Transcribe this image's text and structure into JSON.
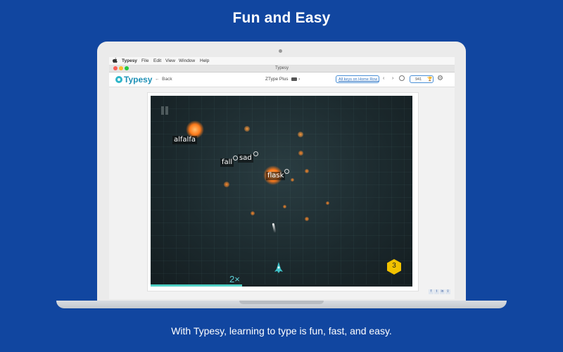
{
  "headline": "Fun and Easy",
  "caption": "With Typesy, learning to type is fun, fast, and easy.",
  "menubar": {
    "apple_icon": "apple-icon",
    "items": [
      "Typesy",
      "File",
      "Edit",
      "View",
      "Window",
      "Help"
    ]
  },
  "window": {
    "title": "Typesy"
  },
  "toolbar": {
    "logo": "Typesy",
    "back_label": "Back",
    "game_name": "ZType Plus",
    "lesson_link": "All keys on Home Row (2)",
    "score": "941"
  },
  "game": {
    "words": [
      "alfalfa",
      "fall",
      "sad",
      "flask"
    ],
    "multiplier": "2×",
    "lives": "3",
    "progress": 0.35
  },
  "social": [
    "f",
    "t",
    "in",
    "share"
  ],
  "colors": {
    "background": "#1146a0",
    "accent": "#2fb6c9",
    "hex_badge": "#f2c200",
    "multiplier": "#5fd0d8"
  }
}
